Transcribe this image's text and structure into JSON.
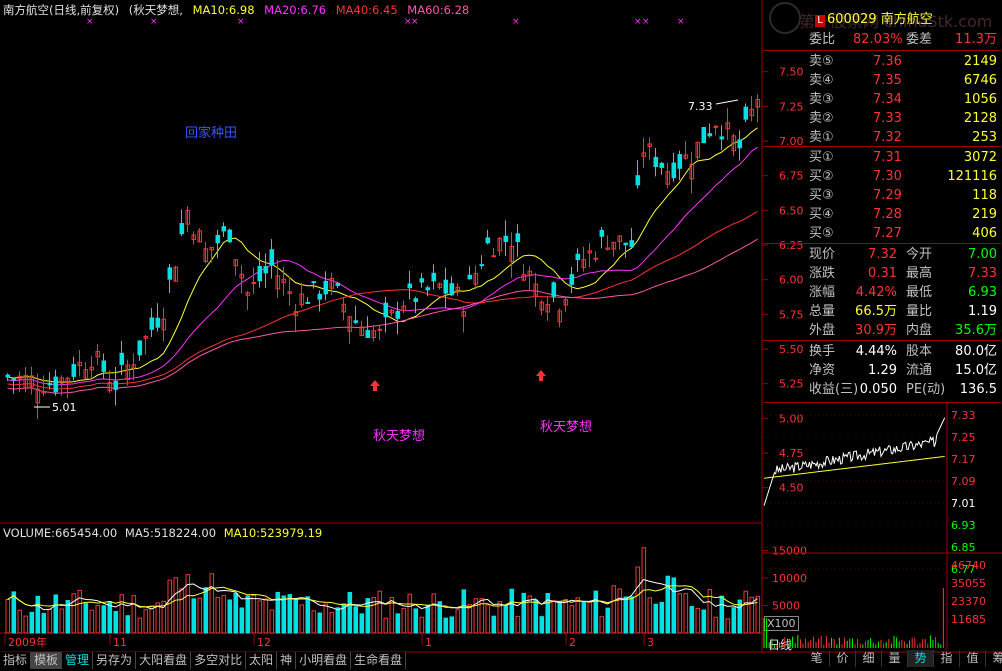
{
  "header": {
    "title": "南方航空(日线,前复权)",
    "indicator": "(秋天梦想,",
    "ma": [
      {
        "label": "MA10:6.98",
        "color": "#ffff33"
      },
      {
        "label": "MA20:6.76",
        "color": "#ff33ff"
      },
      {
        "label": "MA40:6.45",
        "color": "#ff3333"
      },
      {
        "label": "MA60:6.28",
        "color": "#ff55aa"
      }
    ]
  },
  "annotations": {
    "high_label": "7.33",
    "low_label": "5.01",
    "text1": "回家种田",
    "text2": "秋天梦想",
    "text3": "秋天梦想"
  },
  "price_axis": [
    "7.50",
    "7.25",
    "7.00",
    "6.75",
    "6.50",
    "6.25",
    "6.00",
    "5.75",
    "5.50",
    "5.25",
    "5.00",
    "4.75",
    "4.50"
  ],
  "volume_header": {
    "volume": "VOLUME:665454.00",
    "ma5": "MA5:518224.00",
    "ma10": "MA10:523979.19"
  },
  "volume_axis": [
    "15000",
    "10000",
    "5000"
  ],
  "volume_unit": "X100",
  "date_labels": [
    "2009年",
    "11",
    "12",
    "1",
    "2",
    "3"
  ],
  "bottom_tabs": [
    "指标",
    "模板",
    "管理",
    "另存为",
    "大阳看盘",
    "多空对比",
    "太阳",
    "神",
    "小明看盘",
    "生命看盘"
  ],
  "active_tab": "管理",
  "quote": {
    "code_name": "600029 南方航空",
    "weibi_label": "委比",
    "weibi_value": "82.03%",
    "weicha_label": "委差",
    "weicha_value": "11.3万",
    "sell": [
      {
        "label": "卖⑤",
        "price": "7.36",
        "vol": "2149"
      },
      {
        "label": "卖④",
        "price": "7.35",
        "vol": "6746"
      },
      {
        "label": "卖③",
        "price": "7.34",
        "vol": "1056"
      },
      {
        "label": "卖②",
        "price": "7.33",
        "vol": "2128"
      },
      {
        "label": "卖①",
        "price": "7.32",
        "vol": "253"
      }
    ],
    "buy": [
      {
        "label": "买①",
        "price": "7.31",
        "vol": "3072"
      },
      {
        "label": "买②",
        "price": "7.30",
        "vol": "121116"
      },
      {
        "label": "买③",
        "price": "7.29",
        "vol": "118"
      },
      {
        "label": "买④",
        "price": "7.28",
        "vol": "219"
      },
      {
        "label": "买⑤",
        "price": "7.27",
        "vol": "406"
      }
    ],
    "stats": [
      {
        "l1": "现价",
        "v1": "7.32",
        "c1": "#ff3333",
        "l2": "今开",
        "v2": "7.00",
        "c2": "#00ff00"
      },
      {
        "l1": "涨跌",
        "v1": "0.31",
        "c1": "#ff3333",
        "l2": "最高",
        "v2": "7.33",
        "c2": "#ff3333"
      },
      {
        "l1": "涨幅",
        "v1": "4.42%",
        "c1": "#ff3333",
        "l2": "最低",
        "v2": "6.93",
        "c2": "#00ff00"
      },
      {
        "l1": "总量",
        "v1": "66.5万",
        "c1": "#ffff33",
        "l2": "量比",
        "v2": "1.19",
        "c2": "#ffffff"
      },
      {
        "l1": "外盘",
        "v1": "30.9万",
        "c1": "#ff3333",
        "l2": "内盘",
        "v2": "35.6万",
        "c2": "#00ff00"
      }
    ],
    "stats2": [
      {
        "l1": "换手",
        "v1": "4.44%",
        "l2": "股本",
        "v2": "80.0亿"
      },
      {
        "l1": "净资",
        "v1": "1.29",
        "l2": "流通",
        "v2": "15.0亿"
      },
      {
        "l1": "收益(三)",
        "v1": "0.050",
        "l2": "PE(动)",
        "v2": "136.5"
      }
    ]
  },
  "mini_price_axis": [
    "7.33",
    "7.25",
    "7.17",
    "7.09",
    "7.01",
    "6.93",
    "6.85",
    "6.77"
  ],
  "mini_vol_axis": [
    "46740",
    "35055",
    "23370",
    "11685"
  ],
  "right_tabs": [
    "笔",
    "价",
    "细",
    "量",
    "势",
    "指",
    "值",
    "筹"
  ],
  "active_right_tab": "势",
  "day_line_label": "日线",
  "watermark": "第一股票网 chinaStk.com",
  "colors": {
    "up": "#ff3333",
    "down": "#00e0e0",
    "grid": "#7a0000"
  }
}
